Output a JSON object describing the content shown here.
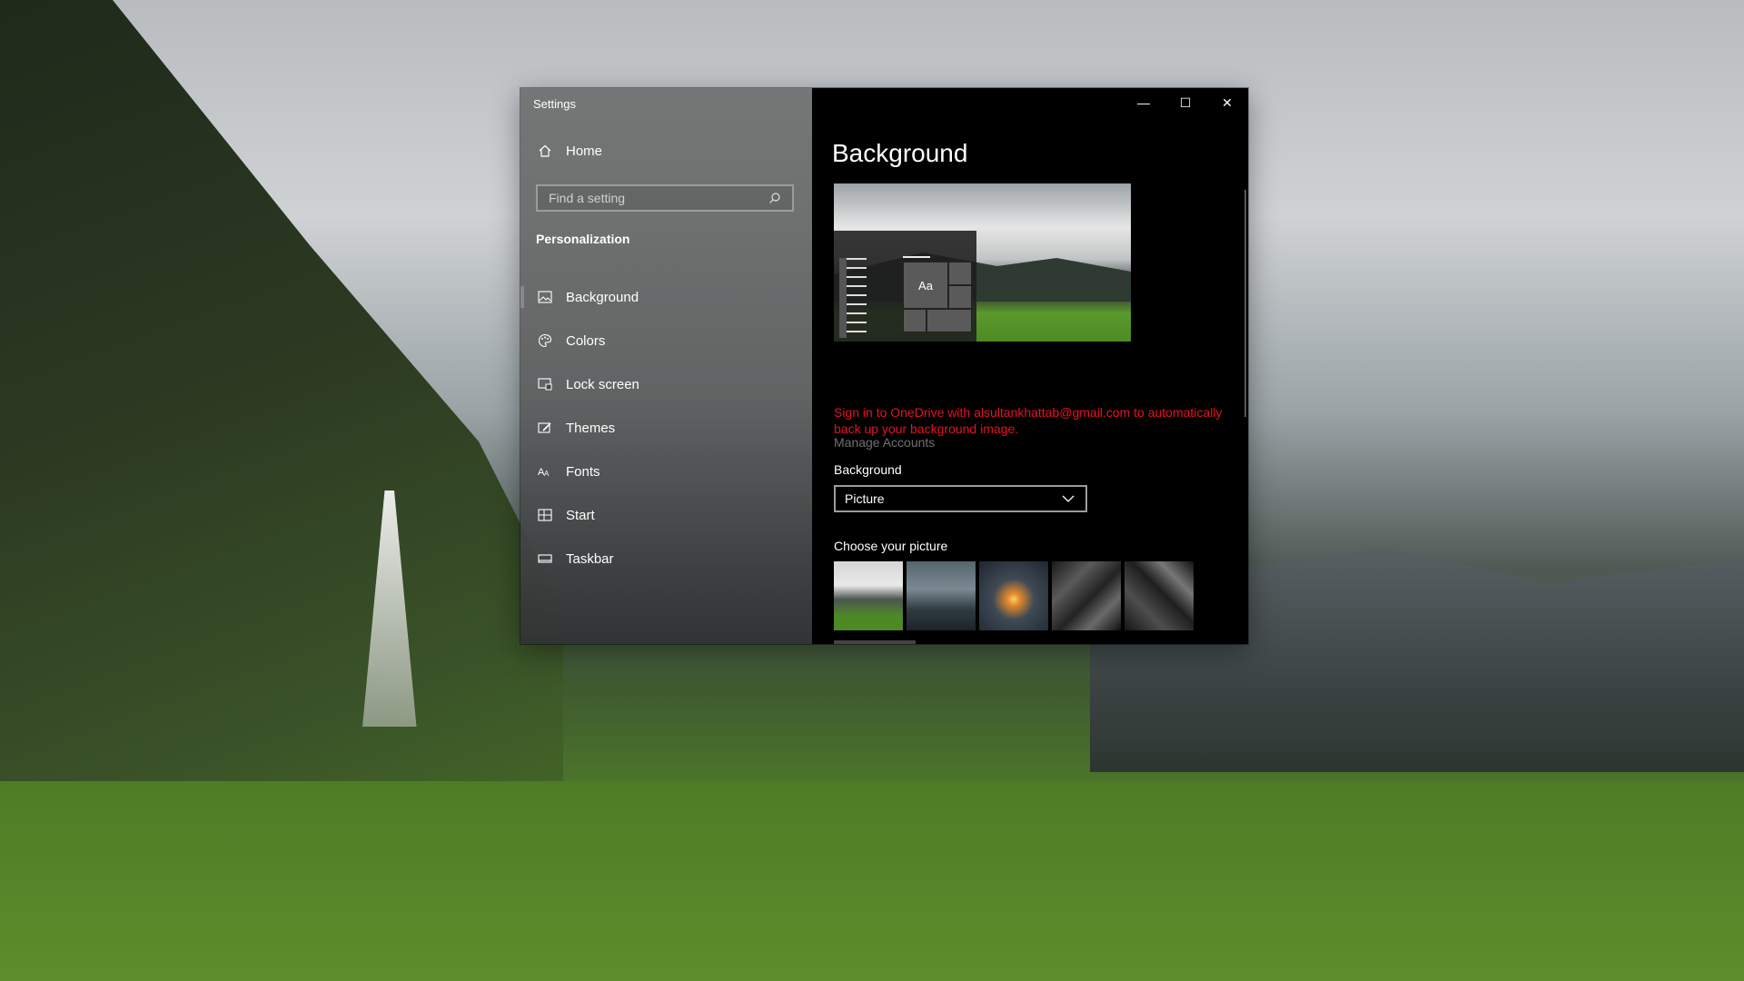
{
  "window": {
    "title": "Settings",
    "caption": {
      "minimize": "—",
      "maximize": "☐",
      "close": "✕"
    }
  },
  "sidebar": {
    "home_label": "Home",
    "search": {
      "placeholder": "Find a setting"
    },
    "section_title": "Personalization",
    "items": [
      {
        "label": "Background",
        "icon": "picture-icon",
        "active": true
      },
      {
        "label": "Colors",
        "icon": "palette-icon"
      },
      {
        "label": "Lock screen",
        "icon": "lock-screen-icon"
      },
      {
        "label": "Themes",
        "icon": "brush-icon"
      },
      {
        "label": "Fonts",
        "icon": "font-icon"
      },
      {
        "label": "Start",
        "icon": "start-icon"
      },
      {
        "label": "Taskbar",
        "icon": "taskbar-icon"
      }
    ]
  },
  "main": {
    "title": "Background",
    "preview": {
      "tile_text": "Aa"
    },
    "onedrive_message": "Sign in to OneDrive with alsultankhattab@gmail.com to automatically back up your background image.",
    "manage_accounts": "Manage Accounts",
    "background_label": "Background",
    "background_value": "Picture",
    "choose_picture_label": "Choose your picture"
  },
  "colors": {
    "accent_error": "#e81123",
    "main_bg": "#000000"
  }
}
